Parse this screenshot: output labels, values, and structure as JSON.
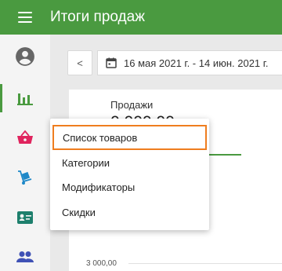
{
  "app_title": "Итоги продаж",
  "icons": {
    "menu": "hamburger-menu-icon",
    "sidebar": [
      "account-circle-icon",
      "bar-chart-icon",
      "basket-icon",
      "hand-truck-icon",
      "id-card-icon",
      "people-icon"
    ]
  },
  "colors": {
    "brand": "#4a9a40",
    "focus": "#ef7d1f"
  },
  "date_nav": {
    "prev_glyph": "<",
    "range": "16 мая 2021 г. - 14 июн. 2021 г."
  },
  "card": {
    "label": "Продажи",
    "value": "0 000,00",
    "axis_tick": "3 000,00"
  },
  "dropdown": {
    "items": [
      {
        "label": "Список товаров",
        "focused": true
      },
      {
        "label": "Категории"
      },
      {
        "label": "Модификаторы"
      },
      {
        "label": "Скидки"
      }
    ]
  }
}
